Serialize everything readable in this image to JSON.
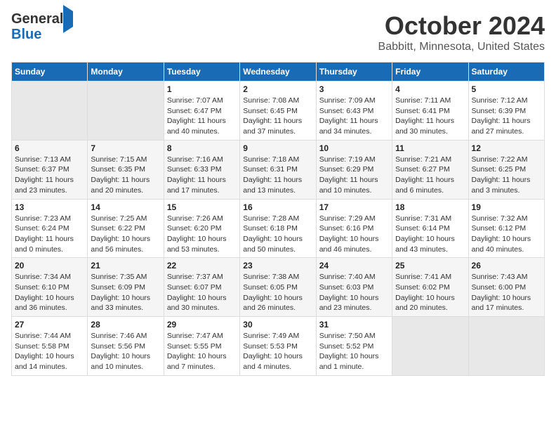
{
  "logo": {
    "line1": "General",
    "line2": "Blue"
  },
  "title": "October 2024",
  "subtitle": "Babbitt, Minnesota, United States",
  "weekdays": [
    "Sunday",
    "Monday",
    "Tuesday",
    "Wednesday",
    "Thursday",
    "Friday",
    "Saturday"
  ],
  "weeks": [
    [
      {
        "day": "",
        "sunrise": "",
        "sunset": "",
        "daylight": ""
      },
      {
        "day": "",
        "sunrise": "",
        "sunset": "",
        "daylight": ""
      },
      {
        "day": "1",
        "sunrise": "Sunrise: 7:07 AM",
        "sunset": "Sunset: 6:47 PM",
        "daylight": "Daylight: 11 hours and 40 minutes."
      },
      {
        "day": "2",
        "sunrise": "Sunrise: 7:08 AM",
        "sunset": "Sunset: 6:45 PM",
        "daylight": "Daylight: 11 hours and 37 minutes."
      },
      {
        "day": "3",
        "sunrise": "Sunrise: 7:09 AM",
        "sunset": "Sunset: 6:43 PM",
        "daylight": "Daylight: 11 hours and 34 minutes."
      },
      {
        "day": "4",
        "sunrise": "Sunrise: 7:11 AM",
        "sunset": "Sunset: 6:41 PM",
        "daylight": "Daylight: 11 hours and 30 minutes."
      },
      {
        "day": "5",
        "sunrise": "Sunrise: 7:12 AM",
        "sunset": "Sunset: 6:39 PM",
        "daylight": "Daylight: 11 hours and 27 minutes."
      }
    ],
    [
      {
        "day": "6",
        "sunrise": "Sunrise: 7:13 AM",
        "sunset": "Sunset: 6:37 PM",
        "daylight": "Daylight: 11 hours and 23 minutes."
      },
      {
        "day": "7",
        "sunrise": "Sunrise: 7:15 AM",
        "sunset": "Sunset: 6:35 PM",
        "daylight": "Daylight: 11 hours and 20 minutes."
      },
      {
        "day": "8",
        "sunrise": "Sunrise: 7:16 AM",
        "sunset": "Sunset: 6:33 PM",
        "daylight": "Daylight: 11 hours and 17 minutes."
      },
      {
        "day": "9",
        "sunrise": "Sunrise: 7:18 AM",
        "sunset": "Sunset: 6:31 PM",
        "daylight": "Daylight: 11 hours and 13 minutes."
      },
      {
        "day": "10",
        "sunrise": "Sunrise: 7:19 AM",
        "sunset": "Sunset: 6:29 PM",
        "daylight": "Daylight: 11 hours and 10 minutes."
      },
      {
        "day": "11",
        "sunrise": "Sunrise: 7:21 AM",
        "sunset": "Sunset: 6:27 PM",
        "daylight": "Daylight: 11 hours and 6 minutes."
      },
      {
        "day": "12",
        "sunrise": "Sunrise: 7:22 AM",
        "sunset": "Sunset: 6:25 PM",
        "daylight": "Daylight: 11 hours and 3 minutes."
      }
    ],
    [
      {
        "day": "13",
        "sunrise": "Sunrise: 7:23 AM",
        "sunset": "Sunset: 6:24 PM",
        "daylight": "Daylight: 11 hours and 0 minutes."
      },
      {
        "day": "14",
        "sunrise": "Sunrise: 7:25 AM",
        "sunset": "Sunset: 6:22 PM",
        "daylight": "Daylight: 10 hours and 56 minutes."
      },
      {
        "day": "15",
        "sunrise": "Sunrise: 7:26 AM",
        "sunset": "Sunset: 6:20 PM",
        "daylight": "Daylight: 10 hours and 53 minutes."
      },
      {
        "day": "16",
        "sunrise": "Sunrise: 7:28 AM",
        "sunset": "Sunset: 6:18 PM",
        "daylight": "Daylight: 10 hours and 50 minutes."
      },
      {
        "day": "17",
        "sunrise": "Sunrise: 7:29 AM",
        "sunset": "Sunset: 6:16 PM",
        "daylight": "Daylight: 10 hours and 46 minutes."
      },
      {
        "day": "18",
        "sunrise": "Sunrise: 7:31 AM",
        "sunset": "Sunset: 6:14 PM",
        "daylight": "Daylight: 10 hours and 43 minutes."
      },
      {
        "day": "19",
        "sunrise": "Sunrise: 7:32 AM",
        "sunset": "Sunset: 6:12 PM",
        "daylight": "Daylight: 10 hours and 40 minutes."
      }
    ],
    [
      {
        "day": "20",
        "sunrise": "Sunrise: 7:34 AM",
        "sunset": "Sunset: 6:10 PM",
        "daylight": "Daylight: 10 hours and 36 minutes."
      },
      {
        "day": "21",
        "sunrise": "Sunrise: 7:35 AM",
        "sunset": "Sunset: 6:09 PM",
        "daylight": "Daylight: 10 hours and 33 minutes."
      },
      {
        "day": "22",
        "sunrise": "Sunrise: 7:37 AM",
        "sunset": "Sunset: 6:07 PM",
        "daylight": "Daylight: 10 hours and 30 minutes."
      },
      {
        "day": "23",
        "sunrise": "Sunrise: 7:38 AM",
        "sunset": "Sunset: 6:05 PM",
        "daylight": "Daylight: 10 hours and 26 minutes."
      },
      {
        "day": "24",
        "sunrise": "Sunrise: 7:40 AM",
        "sunset": "Sunset: 6:03 PM",
        "daylight": "Daylight: 10 hours and 23 minutes."
      },
      {
        "day": "25",
        "sunrise": "Sunrise: 7:41 AM",
        "sunset": "Sunset: 6:02 PM",
        "daylight": "Daylight: 10 hours and 20 minutes."
      },
      {
        "day": "26",
        "sunrise": "Sunrise: 7:43 AM",
        "sunset": "Sunset: 6:00 PM",
        "daylight": "Daylight: 10 hours and 17 minutes."
      }
    ],
    [
      {
        "day": "27",
        "sunrise": "Sunrise: 7:44 AM",
        "sunset": "Sunset: 5:58 PM",
        "daylight": "Daylight: 10 hours and 14 minutes."
      },
      {
        "day": "28",
        "sunrise": "Sunrise: 7:46 AM",
        "sunset": "Sunset: 5:56 PM",
        "daylight": "Daylight: 10 hours and 10 minutes."
      },
      {
        "day": "29",
        "sunrise": "Sunrise: 7:47 AM",
        "sunset": "Sunset: 5:55 PM",
        "daylight": "Daylight: 10 hours and 7 minutes."
      },
      {
        "day": "30",
        "sunrise": "Sunrise: 7:49 AM",
        "sunset": "Sunset: 5:53 PM",
        "daylight": "Daylight: 10 hours and 4 minutes."
      },
      {
        "day": "31",
        "sunrise": "Sunrise: 7:50 AM",
        "sunset": "Sunset: 5:52 PM",
        "daylight": "Daylight: 10 hours and 1 minute."
      },
      {
        "day": "",
        "sunrise": "",
        "sunset": "",
        "daylight": ""
      },
      {
        "day": "",
        "sunrise": "",
        "sunset": "",
        "daylight": ""
      }
    ]
  ]
}
